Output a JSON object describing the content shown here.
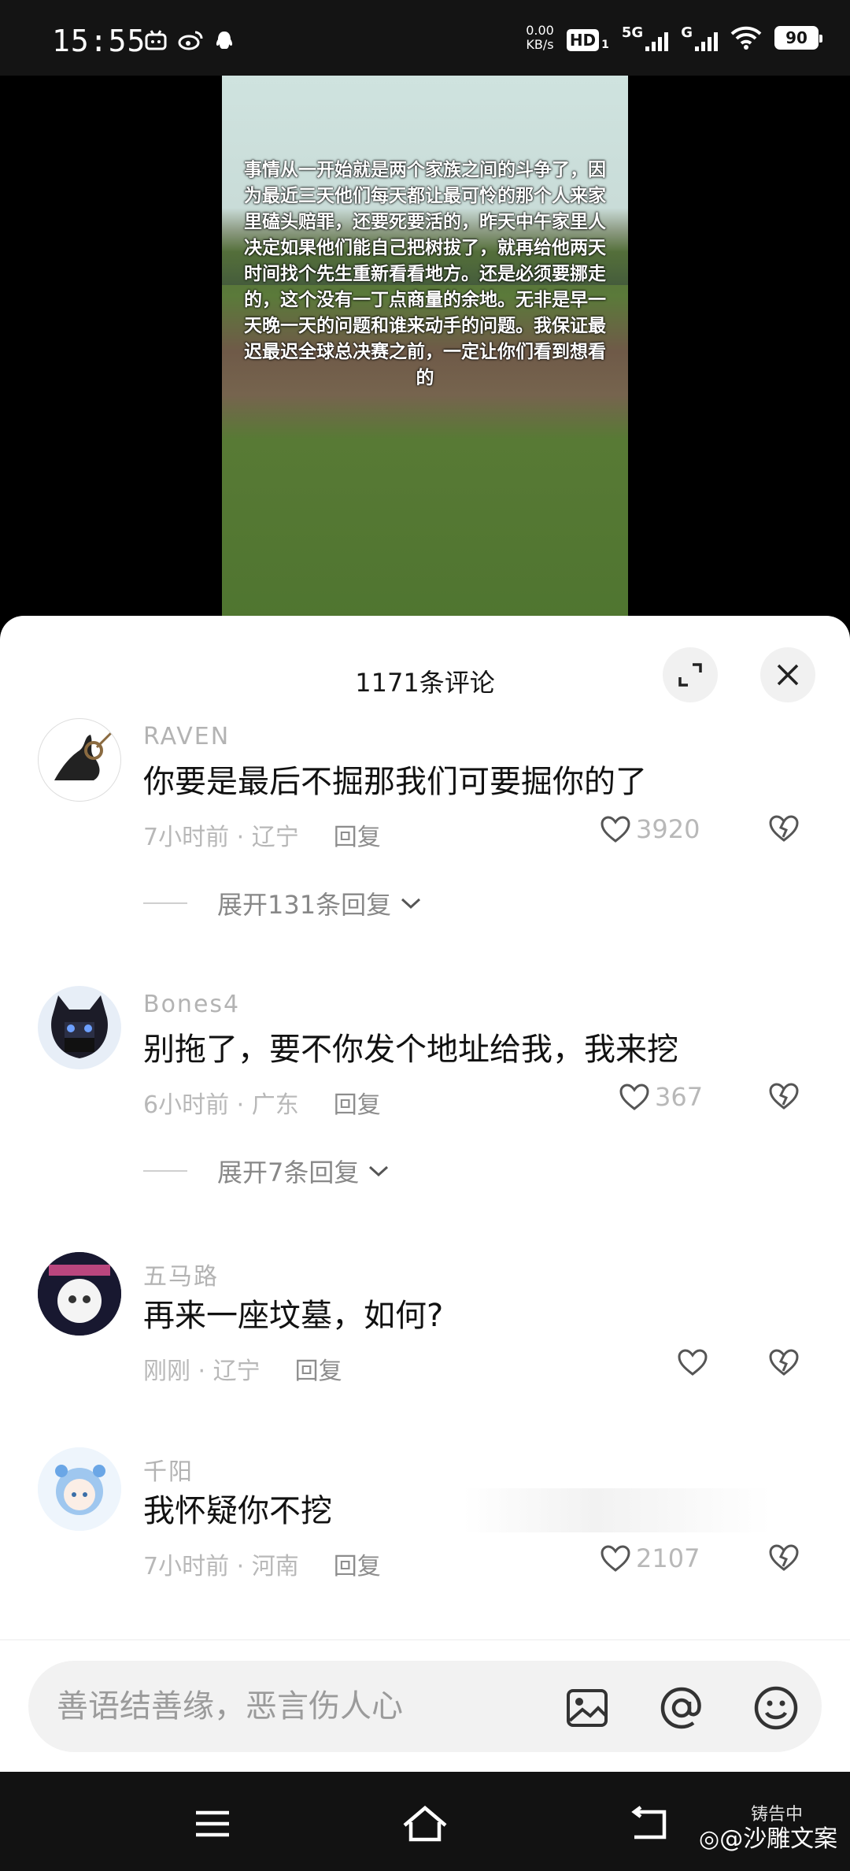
{
  "status_bar": {
    "time": "15:55",
    "net_speed_value": "0.00",
    "net_speed_unit": "KB/s",
    "hd_badge": "HD",
    "hd_sub": "1",
    "sim1_label": "5G",
    "sim2_label": "G",
    "battery": "90"
  },
  "video": {
    "caption": "事情从一开始就是两个家族之间的斗争了，因为最近三天他们每天都让最可怜的那个人来家里磕头赔罪，还要死要活的，昨天中午家里人决定如果他们能自己把树拔了，就再给他两天时间找个先生重新看看地方。还是必须要挪走的，这个没有一丁点商量的余地。无非是早一天晚一天的问题和谁来动手的问题。我保证最迟最迟全球总决赛之前，一定让你们看到想看的"
  },
  "sheet": {
    "title": "1171条评论"
  },
  "comments": [
    {
      "user": "RAVEN",
      "text": "你要是最后不掘那我们可要掘你的了",
      "time": "7小时前",
      "location": "辽宁",
      "reply": "回复",
      "likes": "3920",
      "expand": "展开131条回复"
    },
    {
      "user": "Bones4",
      "text": "别拖了，要不你发个地址给我，我来挖",
      "time": "6小时前",
      "location": "广东",
      "reply": "回复",
      "likes": "367",
      "expand": "展开7条回复"
    },
    {
      "user": "五马路",
      "text": "再来一座坟墓，如何?",
      "time": "刚刚",
      "location": "辽宁",
      "reply": "回复",
      "likes": "",
      "expand": ""
    },
    {
      "user": "千阳",
      "text": "我怀疑你不挖",
      "time": "7小时前",
      "location": "河南",
      "reply": "回复",
      "likes": "2107",
      "expand": ""
    }
  ],
  "input": {
    "placeholder": "善语结善缘，恶言伤人心"
  },
  "watermark": {
    "small": "铸告中",
    "main": "@沙雕文案"
  }
}
